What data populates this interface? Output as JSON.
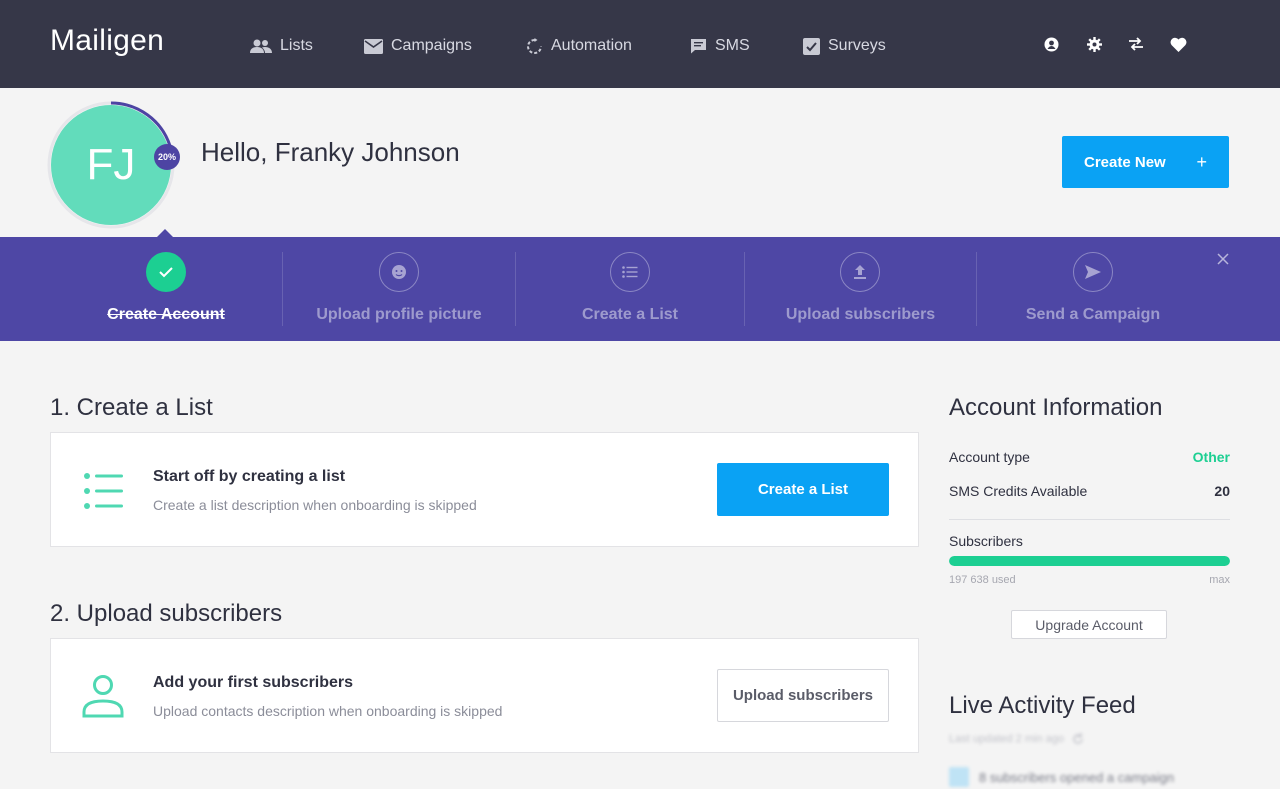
{
  "nav": {
    "logo": "Mailigen",
    "items": [
      {
        "label": "Lists",
        "icon": "users-icon"
      },
      {
        "label": "Campaigns",
        "icon": "envelope-icon"
      },
      {
        "label": "Automation",
        "icon": "refresh-icon"
      },
      {
        "label": "SMS",
        "icon": "message-icon"
      },
      {
        "label": "Surveys",
        "icon": "checkbox-icon"
      }
    ],
    "utilities": [
      "user-icon",
      "gear-icon",
      "swap-icon",
      "heart-icon"
    ]
  },
  "header": {
    "avatar_initials": "FJ",
    "profile_progress_label": "20%",
    "profile_progress": 0.2,
    "greeting": "Hello, Franky Johnson",
    "create_new_label": "Create New",
    "create_new_icon": "+"
  },
  "onboarding": {
    "steps": [
      {
        "label": "Create Account",
        "icon": "check-icon",
        "done": true
      },
      {
        "label": "Upload profile picture",
        "icon": "face-icon",
        "done": false
      },
      {
        "label": "Create a List",
        "icon": "list-icon",
        "done": false
      },
      {
        "label": "Upload subscribers",
        "icon": "upload-icon",
        "done": false
      },
      {
        "label": "Send a Campaign",
        "icon": "send-icon",
        "done": false
      }
    ]
  },
  "main": {
    "sections": [
      {
        "title": "1. Create a List",
        "card_title": "Start off by creating a list",
        "card_desc": "Create a list description when onboarding is skipped",
        "button_label": "Create a List",
        "icon": "list-icon"
      },
      {
        "title": "2. Upload subscribers",
        "card_title": "Add your first subscribers",
        "card_desc": "Upload contacts description when onboarding is skipped",
        "button_label": "Upload subscribers",
        "icon": "person-icon"
      }
    ]
  },
  "account": {
    "title": "Account Information",
    "rows": [
      {
        "label": "Account type",
        "value": "Other"
      },
      {
        "label": "SMS Credits Available",
        "value": "20"
      }
    ],
    "subscribers_label": "Subscribers",
    "subscribers_used": "197 638 used",
    "subscribers_max": "max",
    "subscribers_fill": 1.0,
    "upgrade_label": "Upgrade Account"
  },
  "feed": {
    "title": "Live Activity Feed",
    "updated": "Last updated 2 min ago",
    "items": [
      "8 subscribers opened a campaign"
    ]
  },
  "colors": {
    "nav_bg": "#363748",
    "accent_blue": "#0aa2f4",
    "onboard_bg": "#4e47a5",
    "green": "#1ccf92",
    "avatar": "#62dcbb"
  }
}
